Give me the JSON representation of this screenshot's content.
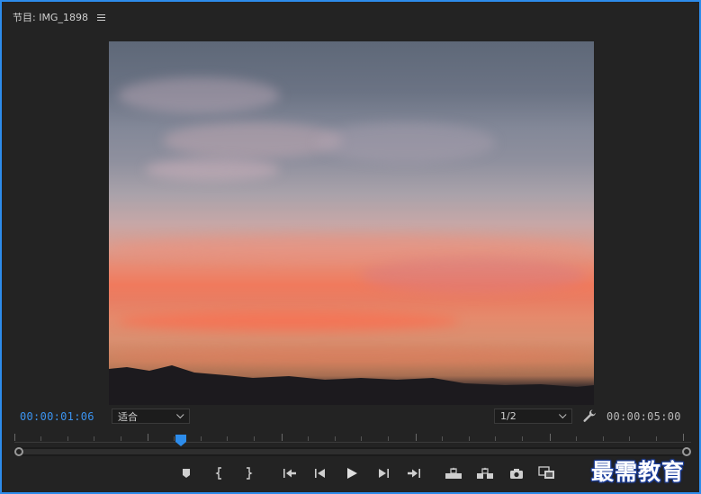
{
  "panel": {
    "title": "节目: IMG_1898",
    "menu_icon": "hamburger-icon"
  },
  "viewer": {
    "image_description": "sunset sky over hills"
  },
  "timecode": {
    "current": "00:00:01:06",
    "duration": "00:00:05:00"
  },
  "fit_dropdown": {
    "selected": "适合"
  },
  "resolution_dropdown": {
    "selected": "1/2"
  },
  "colors": {
    "accent": "#2d8ceb",
    "current_timecode": "#3b93ef",
    "background": "#232323"
  },
  "transport_icons": [
    "add-marker-icon",
    "mark-in-icon",
    "mark-out-icon",
    "go-to-in-icon",
    "step-back-icon",
    "play-icon",
    "step-forward-icon",
    "go-to-out-icon",
    "lift-icon",
    "extract-icon",
    "export-frame-icon",
    "compare-view-icon"
  ],
  "watermark": {
    "text": "最需教育"
  }
}
